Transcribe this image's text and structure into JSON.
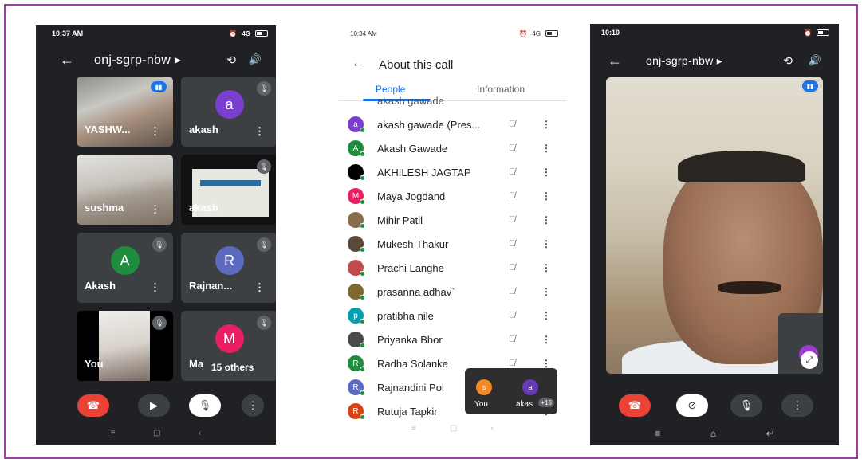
{
  "phone1": {
    "time": "10:37 AM",
    "signal": "4G",
    "title": "onj-sgrp-nbw ▸",
    "tiles": [
      {
        "name": "YASHW...",
        "avatar": ""
      },
      {
        "name": "akash",
        "avatar": "a",
        "color": "#7b3fcf"
      },
      {
        "name": "sushma",
        "avatar": ""
      },
      {
        "name": "akash",
        "avatar": ""
      },
      {
        "name": "Akash",
        "avatar": "A",
        "color": "#1e8e3e"
      },
      {
        "name": "Rajnan...",
        "avatar": "R",
        "color": "#5c6bc0"
      },
      {
        "name": "You",
        "avatar": ""
      },
      {
        "name": "Ma",
        "avatar": "M",
        "color": "#e91e63",
        "others": "15 others"
      }
    ]
  },
  "phone2": {
    "time": "10:34 AM",
    "signal": "4G",
    "title": "About this call",
    "tab_people": "People",
    "tab_info": "Information",
    "partial_name": "akash gawade",
    "people": [
      {
        "name": "akash gawade (Pres...",
        "initial": "a",
        "color": "#7b3fcf"
      },
      {
        "name": "Akash Gawade",
        "initial": "A",
        "color": "#1e8e3e"
      },
      {
        "name": "AKHILESH JAGTAP",
        "initial": "",
        "color": "#000000"
      },
      {
        "name": "Maya Jogdand",
        "initial": "M",
        "color": "#e91e63"
      },
      {
        "name": "Mihir Patil",
        "initial": "",
        "color": "#8a6d4a"
      },
      {
        "name": "Mukesh Thakur",
        "initial": "",
        "color": "#5a4a3a"
      },
      {
        "name": "Prachi Langhe",
        "initial": "",
        "color": "#c14a4a"
      },
      {
        "name": "prasanna adhav`",
        "initial": "",
        "color": "#7a6a30"
      },
      {
        "name": "pratibha nile",
        "initial": "p",
        "color": "#00a0b0"
      },
      {
        "name": "Priyanka Bhor",
        "initial": "",
        "color": "#4a4a4a"
      },
      {
        "name": "Radha Solanke",
        "initial": "R",
        "color": "#1e8e3e"
      },
      {
        "name": "Rajnandini Pol",
        "initial": "R",
        "color": "#5c6bc0"
      },
      {
        "name": "Rutuja Tapkir",
        "initial": "R",
        "color": "#d84315"
      }
    ],
    "mini": {
      "you_initial": "s",
      "you_label": "You",
      "other_initial": "a",
      "other_label": "akas",
      "count": "+18"
    }
  },
  "phone3": {
    "time": "10:10",
    "title": "onj-sgrp-nbw ▸",
    "self_initial": "s"
  },
  "icons": {
    "back": "←",
    "more": "⋮",
    "mic_off": "🎙",
    "end_call": "☎"
  }
}
